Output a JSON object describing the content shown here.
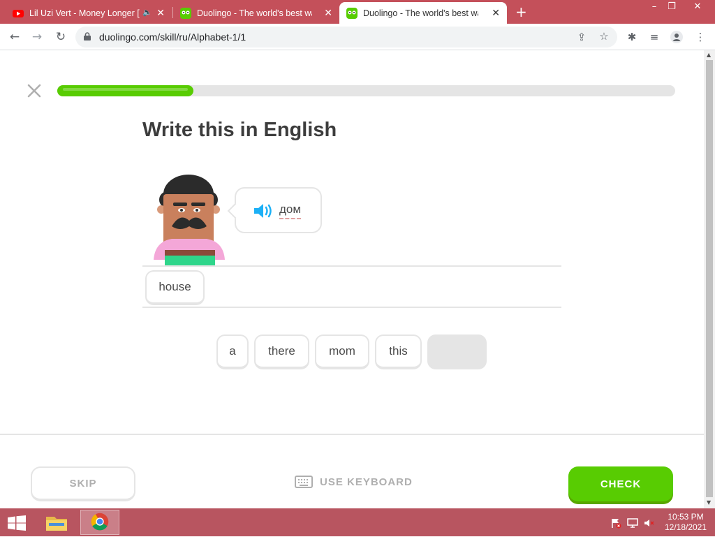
{
  "browser": {
    "tabs": [
      {
        "title": "Lil Uzi Vert - Money Longer [",
        "active": false,
        "muted_icon": "speaker-icon"
      },
      {
        "title": "Duolingo - The world's best way",
        "active": false
      },
      {
        "title": "Duolingo - The world's best way",
        "active": true
      }
    ],
    "url": "duolingo.com/skill/ru/Alphabet-1/1"
  },
  "lesson": {
    "progress_percent": 22,
    "heading": "Write this in English",
    "prompt_word": "дом",
    "answer_tiles": [
      "house"
    ],
    "word_bank": [
      "a",
      "there",
      "mom",
      "this",
      ""
    ]
  },
  "footer": {
    "skip_label": "SKIP",
    "keyboard_label": "USE KEYBOARD",
    "check_label": "CHECK"
  },
  "taskbar": {
    "time": "10:53 PM",
    "date": "12/18/2021"
  },
  "colors": {
    "accent_green": "#58cc02",
    "tab_strip": "#c4505a",
    "taskbar": "#b85560"
  }
}
